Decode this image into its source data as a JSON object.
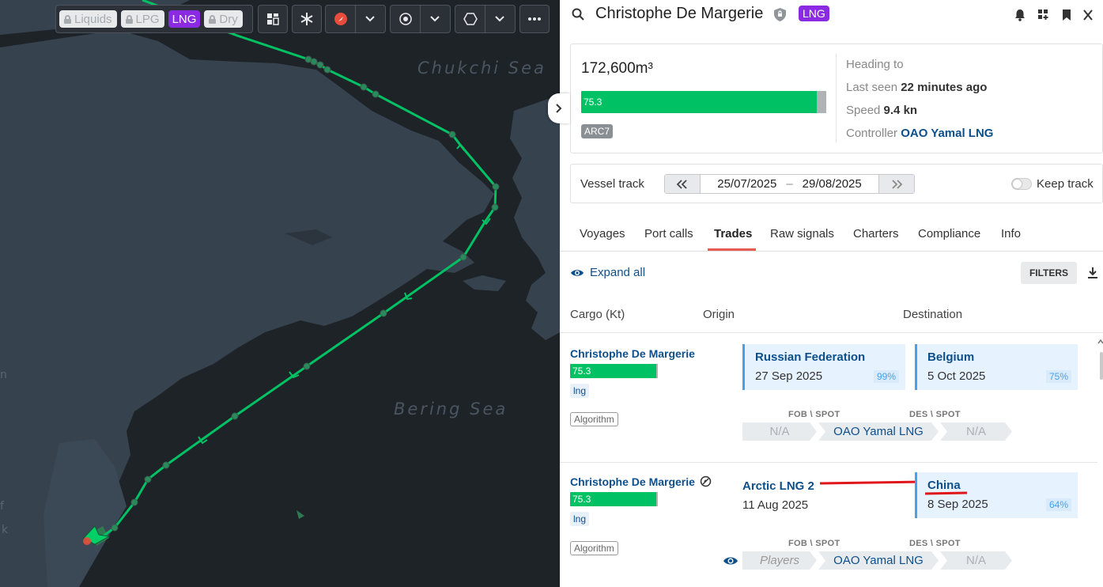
{
  "map": {
    "sea_labels": [
      "Chukchi Sea",
      "Bering Sea"
    ],
    "edge_labels": [
      "n",
      "f",
      "k"
    ],
    "filter_chips": [
      {
        "label": "Liquids",
        "locked": true,
        "active": false
      },
      {
        "label": "LPG",
        "locked": true,
        "active": false
      },
      {
        "label": "LNG",
        "locked": false,
        "active": true
      },
      {
        "label": "Dry",
        "locked": true,
        "active": false
      }
    ],
    "track_color": "#00c264",
    "land_color": "#36434f",
    "sea_color": "#1e2328"
  },
  "header": {
    "vessel_name": "Christophe De Margerie",
    "type_badge": "LNG"
  },
  "summary": {
    "capacity": "172,600m³",
    "fill_value": "75.3",
    "fill_fraction": 0.96,
    "ice_class": "ARC7",
    "heading_label": "Heading to",
    "last_seen_label": "Last seen",
    "last_seen_value": "22 minutes ago",
    "speed_label": "Speed",
    "speed_value": "9.4 kn",
    "controller_label": "Controller",
    "controller_value": "OAO Yamal LNG"
  },
  "vessel_track": {
    "label": "Vessel track",
    "date_from": "25/07/2025",
    "date_to": "29/08/2025",
    "separator": "–",
    "keep_track_label": "Keep track"
  },
  "tabs": [
    "Voyages",
    "Port calls",
    "Trades",
    "Raw signals",
    "Charters",
    "Compliance",
    "Info"
  ],
  "active_tab": "Trades",
  "trades_toolbar": {
    "expand_all": "Expand all",
    "filters": "FILTERS"
  },
  "columns": {
    "cargo": "Cargo (Kt)",
    "origin": "Origin",
    "destination": "Destination"
  },
  "trades": [
    {
      "vessel": "Christophe De Margerie",
      "cargo_value": "75.3",
      "product": "lng",
      "source": "Algorithm",
      "origin_country": "Russian Federation",
      "origin_date": "27 Sep 2025",
      "origin_confidence": "99%",
      "destination_country": "Belgium",
      "destination_date": "5 Oct 2025",
      "destination_confidence": "75%",
      "fob_spot_label": "FOB \\ SPOT",
      "des_spot_label": "DES \\ SPOT",
      "seller": "N/A",
      "charterer": "OAO Yamal LNG",
      "buyer": "N/A"
    },
    {
      "vessel": "Christophe De Margerie",
      "cargo_value": "75.3",
      "product": "lng",
      "source": "Algorithm",
      "origin_terminal": "Arctic LNG 2",
      "origin_date": "11 Aug 2025",
      "destination_country": "China",
      "destination_date": "8 Sep 2025",
      "destination_confidence": "64%",
      "fob_spot_label": "FOB \\ SPOT",
      "des_spot_label": "DES \\ SPOT",
      "seller": "Players",
      "charterer": "OAO Yamal LNG",
      "buyer": "N/A"
    }
  ]
}
